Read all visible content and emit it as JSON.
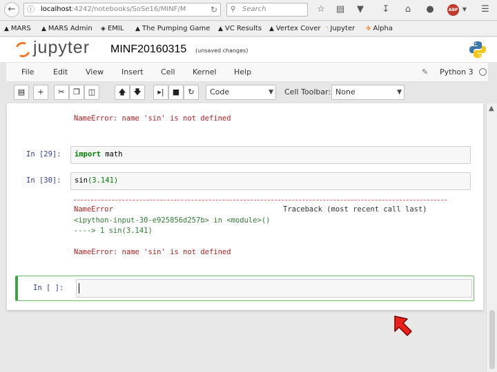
{
  "browser": {
    "url_host": "localhost",
    "url_path": ":4242/notebooks/SoSe16/MINF/M",
    "search_placeholder": "Search"
  },
  "bookmarks": [
    {
      "label": "MARS"
    },
    {
      "label": "MARS Admin"
    },
    {
      "label": "EMIL"
    },
    {
      "label": "The Pumping Game"
    },
    {
      "label": "VC Results"
    },
    {
      "label": "Vertex Cover"
    },
    {
      "label": "Jupyter"
    },
    {
      "label": "Alpha"
    }
  ],
  "header": {
    "logo_text": "jupyter",
    "notebook_name": "MINF20160315",
    "save_status": "(unsaved changes)"
  },
  "menu": {
    "items": [
      "File",
      "Edit",
      "View",
      "Insert",
      "Cell",
      "Kernel",
      "Help"
    ],
    "kernel_name": "Python 3"
  },
  "toolbar": {
    "cell_type": "Code",
    "cell_toolbar_label": "Cell Toolbar:",
    "cell_toolbar_value": "None"
  },
  "cells": {
    "prev_error": "NameError: name 'sin' is not defined",
    "cell29_prompt": "In [29]:",
    "cell29_code_kw": "import",
    "cell29_code_rest": " math",
    "cell30_prompt": "In [30]:",
    "cell30_code_fn": "sin",
    "cell30_code_args": "(3.141)",
    "tb_error_name": "NameError",
    "tb_header": "Traceback (most recent call last)",
    "tb_location": "<ipython-input-30-e925856d257b> in <module>()",
    "tb_arrow": "----> 1 sin(3.141)",
    "tb_final": "NameError: name 'sin' is not defined",
    "active_prompt": "In [ ]:"
  }
}
